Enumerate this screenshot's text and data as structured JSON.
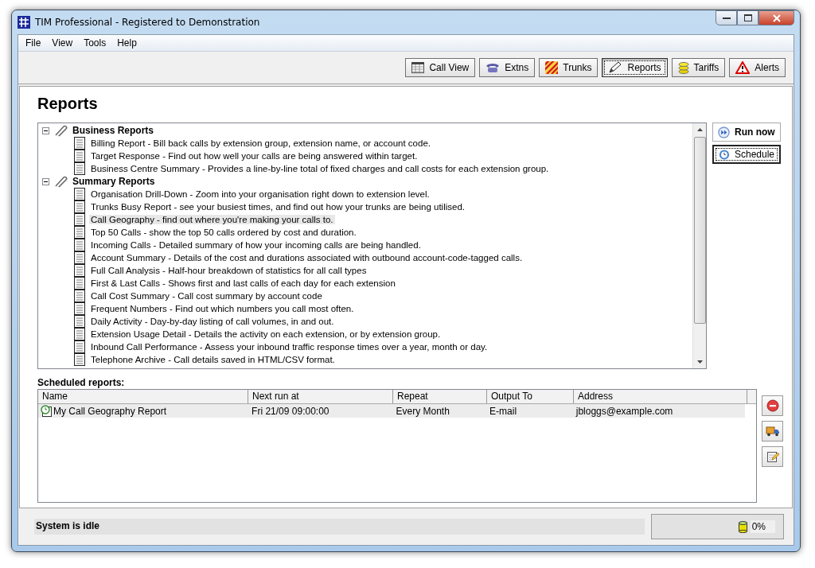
{
  "window": {
    "title": "TIM Professional - Registered to Demonstration"
  },
  "menu": [
    "File",
    "View",
    "Tools",
    "Help"
  ],
  "toolbar": [
    {
      "kind": "callview",
      "label": "Call View",
      "selected": false
    },
    {
      "kind": "extns",
      "label": "Extns",
      "selected": false
    },
    {
      "kind": "trunks",
      "label": "Trunks",
      "selected": false
    },
    {
      "kind": "reports",
      "label": "Reports",
      "selected": true
    },
    {
      "kind": "tariffs",
      "label": "Tariffs",
      "selected": false
    },
    {
      "kind": "alerts",
      "label": "Alerts",
      "selected": false
    }
  ],
  "heading": "Reports",
  "tree": [
    {
      "label": "Business Reports",
      "expanded": true,
      "children": [
        {
          "label": "Billing Report - Bill back calls by extension group, extension name, or account code.",
          "selected": false
        },
        {
          "label": "Target Response - Find out how well your calls are being answered within target.",
          "selected": false
        },
        {
          "label": "Business Centre Summary - Provides a line-by-line total of fixed charges and call costs for each extension group.",
          "selected": false
        }
      ]
    },
    {
      "label": "Summary Reports",
      "expanded": true,
      "children": [
        {
          "label": "Organisation Drill-Down - Zoom into your organisation right down to extension level.",
          "selected": false
        },
        {
          "label": "Trunks Busy Report - see your busiest times, and find out how your trunks are being utilised.",
          "selected": false
        },
        {
          "label": "Call Geography - find out where you're making your calls to.",
          "selected": true
        },
        {
          "label": "Top 50 Calls - show the top 50 calls ordered by cost and duration.",
          "selected": false
        },
        {
          "label": "Incoming Calls - Detailed summary of how your incoming calls are being handled.",
          "selected": false
        },
        {
          "label": "Account Summary - Details of the cost and durations associated with outbound account-code-tagged calls.",
          "selected": false
        },
        {
          "label": "Full Call Analysis - Half-hour breakdown of statistics for all call types",
          "selected": false
        },
        {
          "label": "First & Last Calls - Shows first and last calls of each day for each extension",
          "selected": false
        },
        {
          "label": "Call Cost Summary - Call cost summary by account code",
          "selected": false
        },
        {
          "label": "Frequent Numbers - Find out which numbers you call most often.",
          "selected": false
        },
        {
          "label": "Daily Activity - Day-by-day listing of call volumes, in and out.",
          "selected": false
        },
        {
          "label": "Extension Usage Detail - Details the activity on each extension, or by extension group.",
          "selected": false
        },
        {
          "label": "Inbound Call Performance - Assess your inbound traffic response times over a year, month or day.",
          "selected": false
        },
        {
          "label": "Telephone Archive - Call details saved in HTML/CSV format.",
          "selected": false
        }
      ]
    }
  ],
  "actions": [
    {
      "kind": "run",
      "label": "Run now",
      "selected": false
    },
    {
      "kind": "schedule",
      "label": "Schedule",
      "selected": true
    }
  ],
  "scheduled": {
    "label": "Scheduled reports:",
    "columns": [
      "Name",
      "Next run at",
      "Repeat",
      "Output To",
      "Address"
    ],
    "rows": [
      {
        "selected": true,
        "cells": [
          "My Call Geography Report",
          "Fri 21/09 09:00:00",
          "Every Month",
          "E-mail",
          "jbloggs@example.com"
        ]
      }
    ]
  },
  "status_bar": {
    "message": "System is idle",
    "usage": "0%"
  }
}
